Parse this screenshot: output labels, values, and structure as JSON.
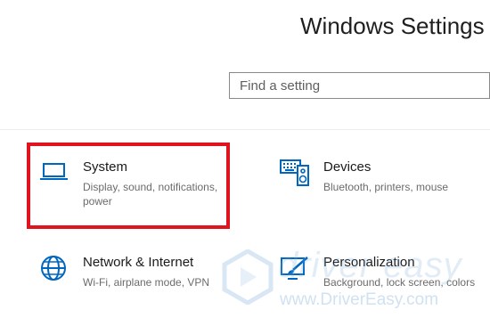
{
  "header": {
    "title": "Windows Settings"
  },
  "search": {
    "placeholder": "Find a setting"
  },
  "tiles": [
    {
      "icon": "laptop-icon",
      "title": "System",
      "description": "Display, sound, notifications, power"
    },
    {
      "icon": "keyboard-speaker-icon",
      "title": "Devices",
      "description": "Bluetooth, printers, mouse"
    },
    {
      "icon": "globe-icon",
      "title": "Network & Internet",
      "description": "Wi-Fi, airplane mode, VPN"
    },
    {
      "icon": "paint-brush-icon",
      "title": "Personalization",
      "description": "Background, lock screen, colors"
    }
  ],
  "watermark": {
    "brand": "driver easy",
    "url": "www.DriverEasy.com"
  },
  "colors": {
    "accent": "#0067c0",
    "highlight": "#e0141f",
    "watermark": "#78aad7"
  }
}
